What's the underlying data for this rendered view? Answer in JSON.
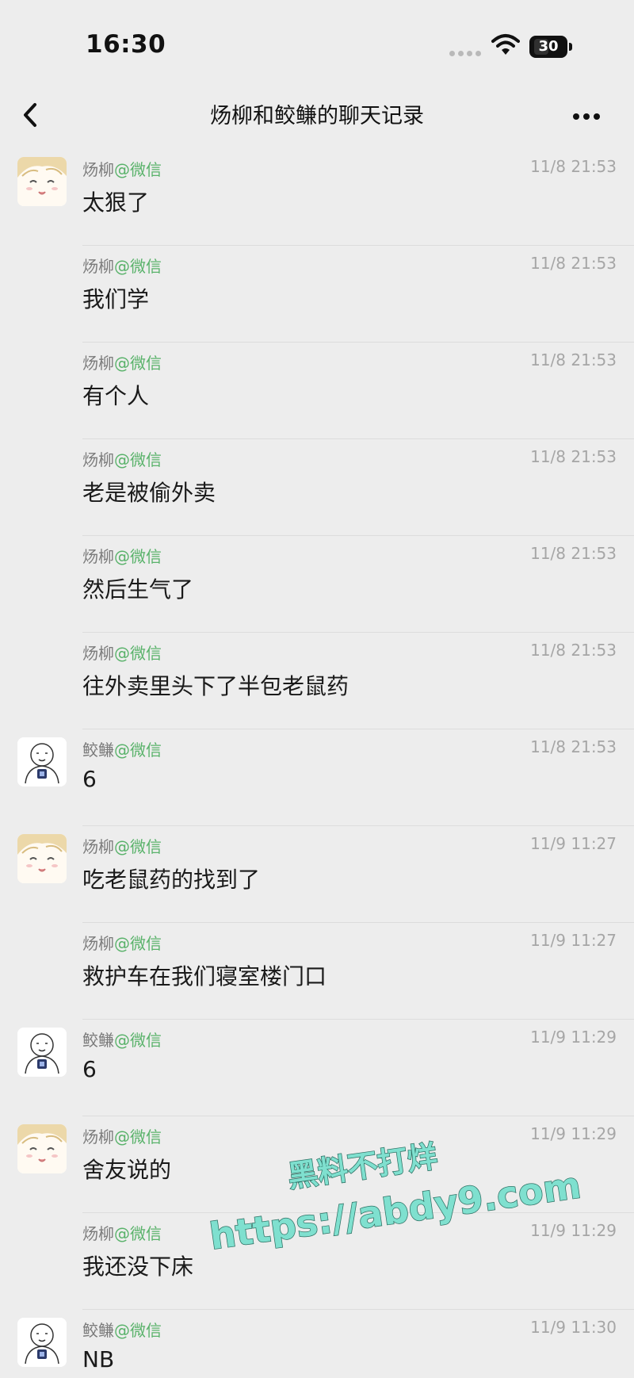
{
  "status": {
    "time": "16:30",
    "battery": "30"
  },
  "nav": {
    "title": "炀柳和鲛鳒的聊天记录"
  },
  "messages": [
    {
      "sender": "炀柳",
      "source": "@微信",
      "time": "11/8 21:53",
      "text": "太狠了",
      "avatar": "girl"
    },
    {
      "sender": "炀柳",
      "source": "@微信",
      "time": "11/8 21:53",
      "text": "我们学",
      "avatar": ""
    },
    {
      "sender": "炀柳",
      "source": "@微信",
      "time": "11/8 21:53",
      "text": "有个人",
      "avatar": ""
    },
    {
      "sender": "炀柳",
      "source": "@微信",
      "time": "11/8 21:53",
      "text": "老是被偷外卖",
      "avatar": ""
    },
    {
      "sender": "炀柳",
      "source": "@微信",
      "time": "11/8 21:53",
      "text": "然后生气了",
      "avatar": ""
    },
    {
      "sender": "炀柳",
      "source": "@微信",
      "time": "11/8 21:53",
      "text": "往外卖里头下了半包老鼠药",
      "avatar": ""
    },
    {
      "sender": "鲛鳒",
      "source": "@微信",
      "time": "11/8 21:53",
      "text": "6",
      "avatar": "sketch"
    },
    {
      "sender": "炀柳",
      "source": "@微信",
      "time": "11/9 11:27",
      "text": "吃老鼠药的找到了",
      "avatar": "girl"
    },
    {
      "sender": "炀柳",
      "source": "@微信",
      "time": "11/9 11:27",
      "text": "救护车在我们寝室楼门口",
      "avatar": ""
    },
    {
      "sender": "鲛鳒",
      "source": "@微信",
      "time": "11/9 11:29",
      "text": "6",
      "avatar": "sketch"
    },
    {
      "sender": "炀柳",
      "source": "@微信",
      "time": "11/9 11:29",
      "text": "舍友说的",
      "avatar": "girl"
    },
    {
      "sender": "炀柳",
      "source": "@微信",
      "time": "11/9 11:29",
      "text": "我还没下床",
      "avatar": ""
    },
    {
      "sender": "鲛鳒",
      "source": "@微信",
      "time": "11/9 11:30",
      "text": "NB",
      "avatar": "sketch"
    }
  ],
  "watermark": {
    "line1": "黑料不打烊",
    "line2": "https://abdy9.com",
    "color": "#7fe0cf"
  }
}
